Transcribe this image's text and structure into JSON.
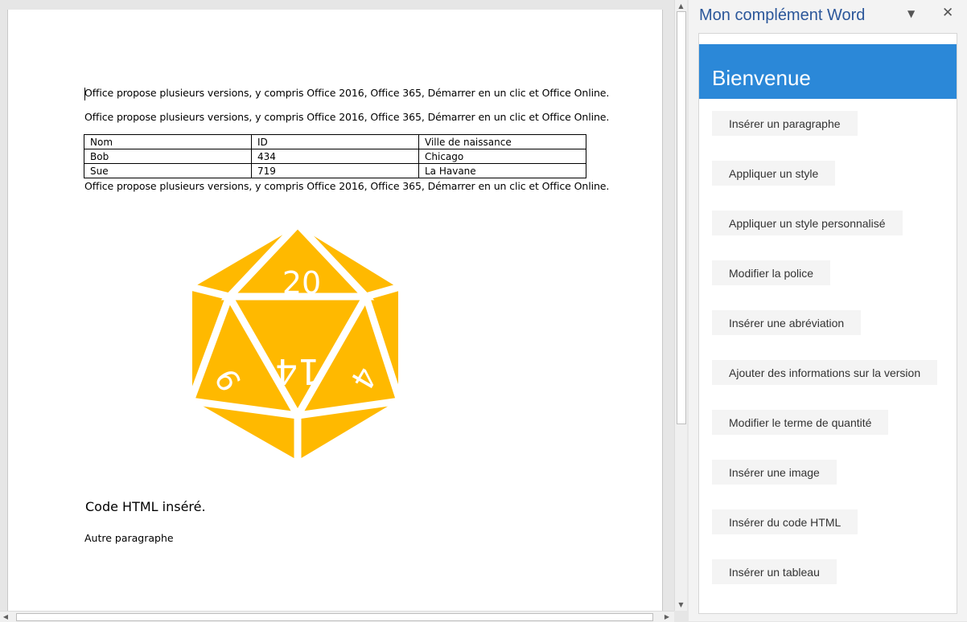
{
  "document": {
    "paragraph_1": "Office propose plusieurs versions, y compris Office 2016, Office 365, Démarrer en un clic et Office Online.",
    "paragraph_2": "Office propose plusieurs versions, y compris Office 2016, Office 365, Démarrer en un clic et Office Online.",
    "table": {
      "headers": [
        "Nom",
        "ID",
        "Ville de naissance"
      ],
      "rows": [
        [
          "Bob",
          "434",
          "Chicago"
        ],
        [
          "Sue",
          "719",
          "La Havane"
        ]
      ]
    },
    "paragraph_3": "Office propose plusieurs versions, y compris Office 2016, Office 365, Démarrer en un clic et Office Online.",
    "dice_numbers": [
      "20",
      "14",
      "9",
      "4"
    ],
    "html_inserted_text": "Code HTML inséré.",
    "other_paragraph": "Autre paragraphe"
  },
  "colors": {
    "dice": "#ffb900",
    "pane_banner": "#2b88d8",
    "pane_title": "#2b579a"
  },
  "taskpane": {
    "title": "Mon complément Word",
    "menu_icon": "chevron-down-icon",
    "close_icon": "close-icon",
    "banner_title": "Bienvenue",
    "buttons": [
      "Insérer un paragraphe",
      "Appliquer un style",
      "Appliquer un style personnalisé",
      "Modifier la police",
      "Insérer une abréviation",
      "Ajouter des informations sur la version",
      "Modifier le terme de quantité",
      "Insérer une image",
      "Insérer du code HTML",
      "Insérer un tableau"
    ]
  }
}
